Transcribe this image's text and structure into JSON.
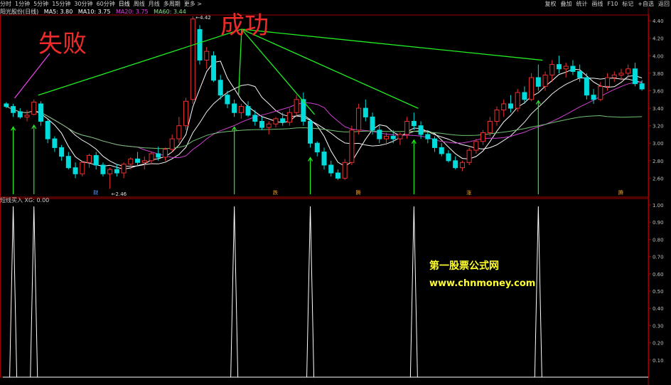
{
  "toolbar": {
    "periods": [
      "分时",
      "1分钟",
      "5分钟",
      "15分钟",
      "30分钟",
      "60分钟",
      "日线",
      "周线",
      "月线",
      "多周期",
      "更多 >"
    ],
    "tools": [
      "复权",
      "叠加",
      "统计",
      "画线",
      "F10",
      "标记",
      "+自选",
      "返回"
    ]
  },
  "legend": {
    "stock": "阳光股份(日线)",
    "ma5": "MA5: 3.80",
    "ma10": "MA10: 3.75",
    "ma20": "MA20: 3.75",
    "ma60": "MA60: 3.44"
  },
  "sub_legend": "短线买入  XG: 0.00",
  "annotations": {
    "fail": "失败",
    "success": "成功"
  },
  "watermark": {
    "line1": "第一股票公式网",
    "line2": "www.chnmoney.com"
  },
  "colors": {
    "up": "#ee3030",
    "down": "#00dcdc",
    "ma5": "#ffffff",
    "ma10": "#f0f0f0",
    "ma20": "#d040d0",
    "ma60": "#70c070",
    "arrow": "#22ee22",
    "axis": "#a00000"
  },
  "chart_data": [
    {
      "type": "candlestick",
      "title": "阳光股份(日线)",
      "y_ticks": [
        "4.40",
        "4.20",
        "4.00",
        "3.80",
        "3.60",
        "3.40",
        "3.20",
        "3.00",
        "2.80",
        "2.60"
      ],
      "ylim": [
        2.46,
        4.42
      ],
      "high_label": "4.42",
      "low_label": "2.46",
      "event_markers": [
        "财",
        "跌",
        "腾",
        "涨",
        "腾"
      ],
      "ohlc": [
        [
          3.45,
          3.47,
          3.4,
          3.42
        ],
        [
          3.42,
          3.45,
          3.3,
          3.35
        ],
        [
          3.36,
          3.4,
          3.28,
          3.3
        ],
        [
          3.3,
          3.38,
          3.25,
          3.32
        ],
        [
          3.33,
          3.5,
          3.32,
          3.47
        ],
        [
          3.45,
          3.48,
          3.2,
          3.25
        ],
        [
          3.25,
          3.27,
          3.0,
          3.05
        ],
        [
          3.05,
          3.08,
          2.9,
          2.95
        ],
        [
          2.95,
          2.98,
          2.8,
          2.85
        ],
        [
          2.85,
          2.9,
          2.7,
          2.72
        ],
        [
          2.72,
          2.78,
          2.6,
          2.65
        ],
        [
          2.65,
          2.8,
          2.62,
          2.78
        ],
        [
          2.78,
          2.88,
          2.72,
          2.86
        ],
        [
          2.86,
          2.9,
          2.7,
          2.75
        ],
        [
          2.75,
          2.78,
          2.62,
          2.65
        ],
        [
          2.65,
          2.72,
          2.48,
          2.7
        ],
        [
          2.7,
          2.76,
          2.62,
          2.66
        ],
        [
          2.66,
          2.78,
          2.6,
          2.76
        ],
        [
          2.76,
          2.84,
          2.7,
          2.82
        ],
        [
          2.82,
          2.9,
          2.74,
          2.78
        ],
        [
          2.78,
          2.85,
          2.7,
          2.8
        ],
        [
          2.8,
          2.9,
          2.76,
          2.88
        ],
        [
          2.88,
          2.96,
          2.8,
          2.84
        ],
        [
          2.84,
          2.95,
          2.8,
          2.93
        ],
        [
          2.93,
          3.1,
          2.9,
          3.05
        ],
        [
          3.05,
          3.3,
          3.0,
          3.2
        ],
        [
          3.2,
          3.52,
          3.15,
          3.48
        ],
        [
          3.5,
          4.45,
          3.45,
          4.42
        ],
        [
          4.3,
          4.35,
          3.9,
          3.95
        ],
        [
          3.95,
          4.1,
          3.85,
          4.05
        ],
        [
          4.0,
          4.05,
          3.7,
          3.72
        ],
        [
          3.72,
          3.78,
          3.5,
          3.55
        ],
        [
          3.55,
          3.6,
          3.4,
          3.45
        ],
        [
          3.45,
          3.5,
          3.3,
          3.35
        ],
        [
          3.35,
          3.45,
          3.28,
          3.42
        ],
        [
          3.42,
          3.48,
          3.3,
          3.32
        ],
        [
          3.32,
          3.38,
          3.2,
          3.25
        ],
        [
          3.25,
          3.3,
          3.15,
          3.18
        ],
        [
          3.18,
          3.25,
          3.1,
          3.22
        ],
        [
          3.22,
          3.3,
          3.18,
          3.28
        ],
        [
          3.28,
          3.35,
          3.2,
          3.24
        ],
        [
          3.24,
          3.4,
          3.2,
          3.35
        ],
        [
          3.35,
          3.55,
          3.3,
          3.5
        ],
        [
          3.5,
          3.58,
          3.2,
          3.25
        ],
        [
          3.25,
          3.28,
          2.95,
          3.0
        ],
        [
          3.0,
          3.02,
          2.85,
          2.9
        ],
        [
          2.9,
          2.95,
          2.7,
          2.75
        ],
        [
          2.75,
          2.8,
          2.62,
          2.66
        ],
        [
          2.66,
          2.7,
          2.58,
          2.6
        ],
        [
          2.6,
          2.82,
          2.58,
          2.78
        ],
        [
          2.78,
          3.2,
          2.75,
          3.15
        ],
        [
          3.15,
          3.45,
          3.1,
          3.4
        ],
        [
          3.4,
          3.5,
          3.25,
          3.3
        ],
        [
          3.3,
          3.35,
          3.1,
          3.15
        ],
        [
          3.15,
          3.2,
          3.0,
          3.05
        ],
        [
          3.05,
          3.12,
          2.98,
          3.08
        ],
        [
          3.08,
          3.15,
          3.0,
          3.05
        ],
        [
          3.05,
          3.12,
          2.98,
          3.1
        ],
        [
          3.1,
          3.3,
          3.05,
          3.25
        ],
        [
          3.25,
          3.35,
          3.15,
          3.2
        ],
        [
          3.2,
          3.25,
          3.05,
          3.1
        ],
        [
          3.1,
          3.15,
          3.0,
          3.05
        ],
        [
          3.05,
          3.08,
          2.9,
          2.95
        ],
        [
          2.95,
          3.0,
          2.85,
          2.88
        ],
        [
          2.88,
          2.92,
          2.78,
          2.8
        ],
        [
          2.8,
          2.85,
          2.7,
          2.72
        ],
        [
          2.72,
          2.8,
          2.68,
          2.78
        ],
        [
          2.78,
          2.95,
          2.75,
          2.92
        ],
        [
          2.92,
          3.05,
          2.88,
          3.02
        ],
        [
          3.02,
          3.15,
          2.98,
          3.12
        ],
        [
          3.12,
          3.3,
          3.08,
          3.25
        ],
        [
          3.25,
          3.42,
          3.2,
          3.38
        ],
        [
          3.38,
          3.5,
          3.3,
          3.45
        ],
        [
          3.45,
          3.55,
          3.35,
          3.4
        ],
        [
          3.4,
          3.62,
          3.36,
          3.58
        ],
        [
          3.58,
          3.65,
          3.45,
          3.5
        ],
        [
          3.5,
          3.8,
          3.48,
          3.75
        ],
        [
          3.75,
          3.9,
          3.6,
          3.65
        ],
        [
          3.65,
          3.82,
          3.6,
          3.78
        ],
        [
          3.78,
          3.95,
          3.7,
          3.9
        ],
        [
          3.9,
          4.0,
          3.8,
          3.85
        ],
        [
          3.85,
          3.92,
          3.75,
          3.88
        ],
        [
          3.88,
          3.95,
          3.78,
          3.82
        ],
        [
          3.82,
          3.9,
          3.7,
          3.75
        ],
        [
          3.75,
          3.8,
          3.5,
          3.55
        ],
        [
          3.55,
          3.62,
          3.45,
          3.5
        ],
        [
          3.5,
          3.7,
          3.48,
          3.65
        ],
        [
          3.65,
          3.8,
          3.6,
          3.75
        ],
        [
          3.75,
          3.82,
          3.7,
          3.78
        ],
        [
          3.78,
          3.85,
          3.72,
          3.8
        ],
        [
          3.8,
          3.9,
          3.75,
          3.85
        ],
        [
          3.85,
          3.92,
          3.65,
          3.68
        ],
        [
          3.68,
          3.72,
          3.6,
          3.62
        ]
      ]
    },
    {
      "type": "line",
      "title": "短线买入",
      "series": [
        {
          "name": "XG",
          "signal_indices": [
            1,
            4,
            33,
            44,
            59,
            77
          ]
        }
      ],
      "y_ticks": [
        "1.00",
        "0.90",
        "0.80",
        "0.70",
        "0.60",
        "0.50",
        "0.40",
        "0.30",
        "0.20",
        "0.10"
      ],
      "ylim": [
        0,
        1
      ]
    }
  ]
}
